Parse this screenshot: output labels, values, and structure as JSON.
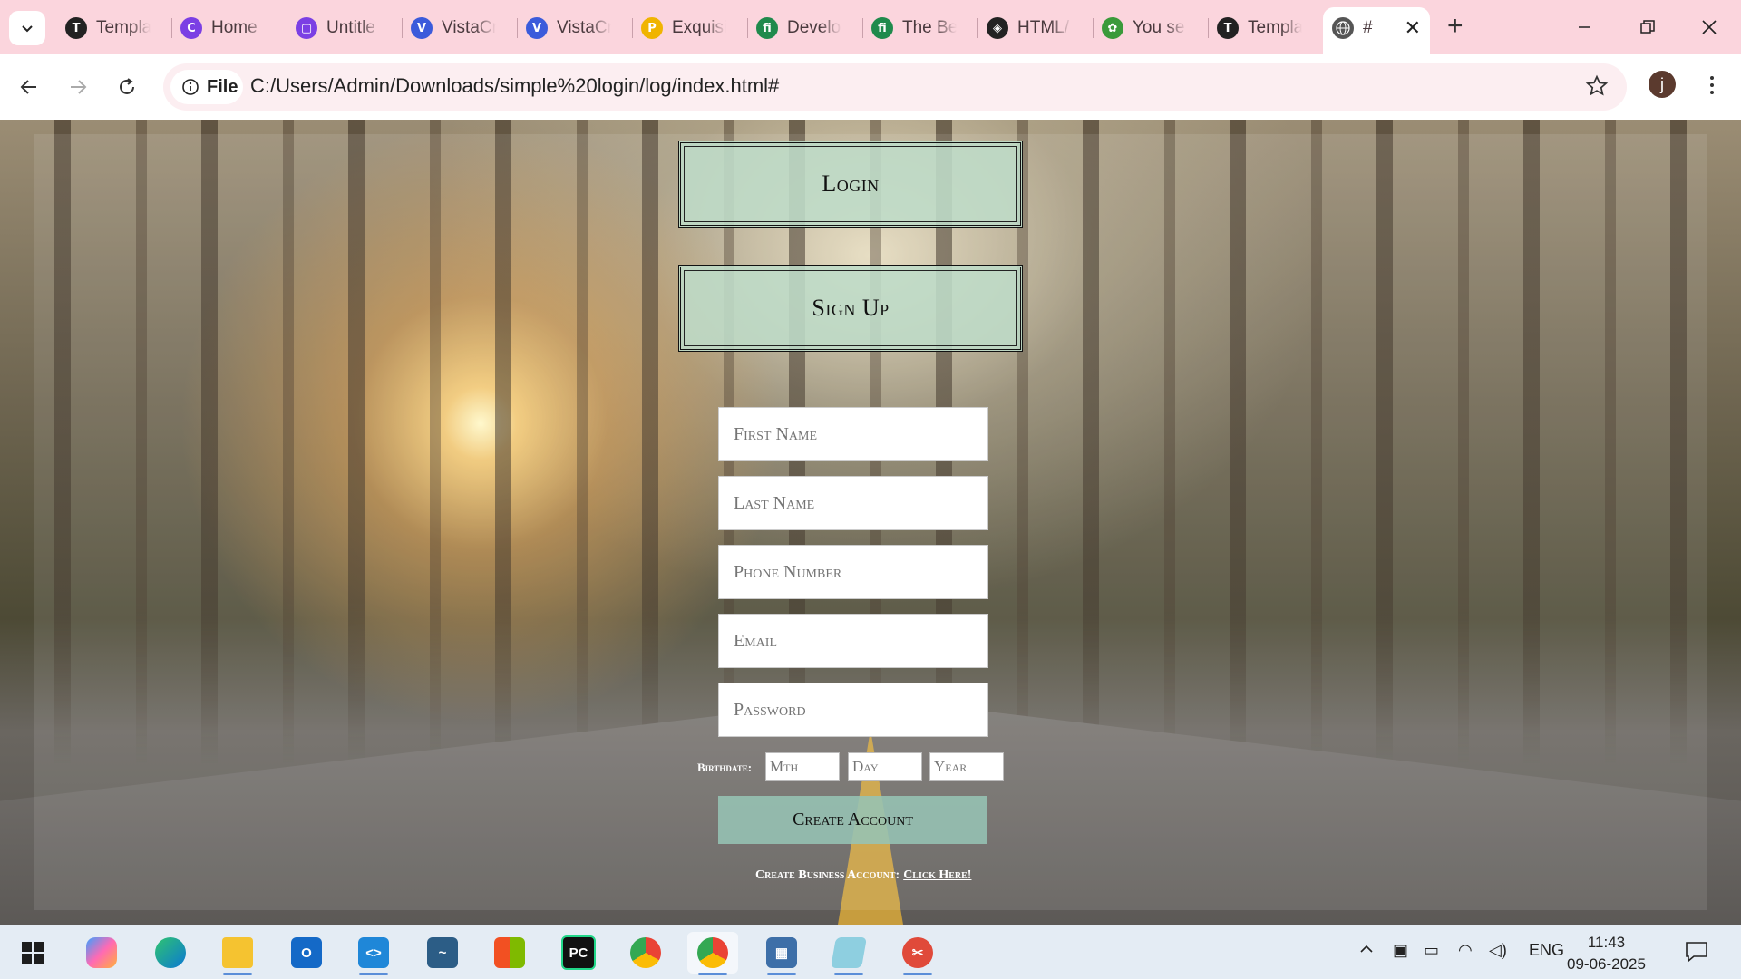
{
  "browser": {
    "tabs": [
      {
        "title": "Templa",
        "favicon": "T",
        "color": "#222222"
      },
      {
        "title": "Home",
        "favicon": "C",
        "color": "#7b3fe4"
      },
      {
        "title": "Untitle",
        "favicon": "▢",
        "color": "#7b3fe4"
      },
      {
        "title": "VistaCr",
        "favicon": "V",
        "color": "#3b5bdb"
      },
      {
        "title": "VistaCr",
        "favicon": "V",
        "color": "#3b5bdb"
      },
      {
        "title": "Exquisi",
        "favicon": "P",
        "color": "#f0b400"
      },
      {
        "title": "Develo",
        "favicon": "fi",
        "color": "#1f8a4c"
      },
      {
        "title": "The Be",
        "favicon": "fi",
        "color": "#1f8a4c"
      },
      {
        "title": "HTML/",
        "favicon": "◈",
        "color": "#222222"
      },
      {
        "title": "You se",
        "favicon": "✿",
        "color": "#3a9a3a"
      },
      {
        "title": "Templa",
        "favicon": "T",
        "color": "#222222"
      }
    ],
    "active_tab": {
      "title": "#",
      "favicon": "globe-icon"
    },
    "chip_label": "File",
    "url": "C:/Users/Admin/Downloads/simple%20login/log/index.html#",
    "profile_initial": "j"
  },
  "page": {
    "login_label": "Login",
    "signup_label": "Sign Up",
    "fields": {
      "first_name": "First Name",
      "last_name": "Last Name",
      "phone": "Phone Number",
      "email": "Email",
      "password": "Password"
    },
    "birthdate": {
      "label": "Birthdate:",
      "month": "Mth",
      "day": "Day",
      "year": "Year"
    },
    "create_label": "Create Account",
    "business": {
      "text": "Create Business Account:",
      "link": "Click Here!"
    }
  },
  "taskbar": {
    "apps": [
      "windows-start",
      "copilot",
      "edge",
      "file-explorer",
      "outlook",
      "vscode",
      "mysql-workbench",
      "microsoft-store",
      "pycharm",
      "chrome",
      "chrome-profile",
      "calculator",
      "notepad",
      "snipping-tool"
    ],
    "lang": "ENG",
    "time": "11:43",
    "date": "09-06-2025"
  },
  "colors": {
    "tabstrip": "#fbd5dd",
    "omnibox": "#fceef1",
    "button_green": "#bedcc8",
    "create_green": "#96c3b4"
  }
}
